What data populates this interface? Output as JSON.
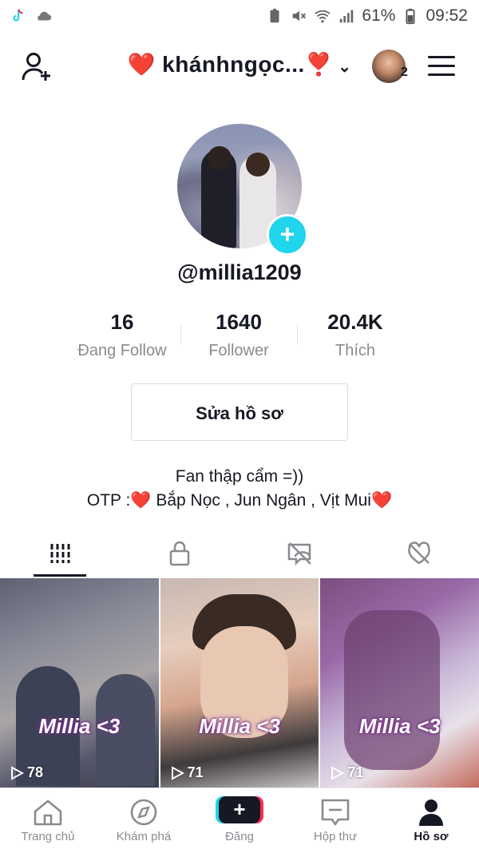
{
  "status_bar": {
    "battery_pct": "61%",
    "time": "09:52",
    "icons": [
      "tiktok-icon",
      "cloud-icon",
      "battery-saver-icon",
      "mute-icon",
      "wifi-icon",
      "signal-icon",
      "battery-icon"
    ]
  },
  "header": {
    "title": "❤️ khánhngọc...❣️",
    "account_count": "2",
    "icons": [
      "add-user-icon",
      "chevron-down-icon",
      "avatar",
      "menu-icon"
    ]
  },
  "profile": {
    "username": "@millia1209",
    "stats": [
      {
        "value": "16",
        "label": "Đang Follow"
      },
      {
        "value": "1640",
        "label": "Follower"
      },
      {
        "value": "20.4K",
        "label": "Thích"
      }
    ],
    "edit_label": "Sửa hồ sơ",
    "bio_line1": "Fan thập cẩm =))",
    "bio_line2": "OTP :❤️  Bắp Nọc , Jun Ngân , Vịt Mui❤️"
  },
  "tabs": [
    "videos-grid-icon",
    "lock-icon",
    "tagged-hidden-icon",
    "liked-hidden-icon"
  ],
  "videos": [
    {
      "caption": "Millia <3",
      "views": "78"
    },
    {
      "caption": "Millia <3",
      "views": "71"
    },
    {
      "caption": "Millia <3",
      "views": "71"
    }
  ],
  "bottom_nav": [
    {
      "label": "Trang chủ",
      "icon": "home-icon"
    },
    {
      "label": "Khám phá",
      "icon": "compass-icon"
    },
    {
      "label": "Đăng",
      "icon": "plus-icon"
    },
    {
      "label": "Hộp thư",
      "icon": "inbox-icon"
    },
    {
      "label": "Hồ sơ",
      "icon": "profile-icon",
      "active": true
    }
  ],
  "colors": {
    "accent_cyan": "#20d5ec",
    "accent_pink": "#fe2c55",
    "text": "#161823",
    "muted": "#8a8b91"
  }
}
